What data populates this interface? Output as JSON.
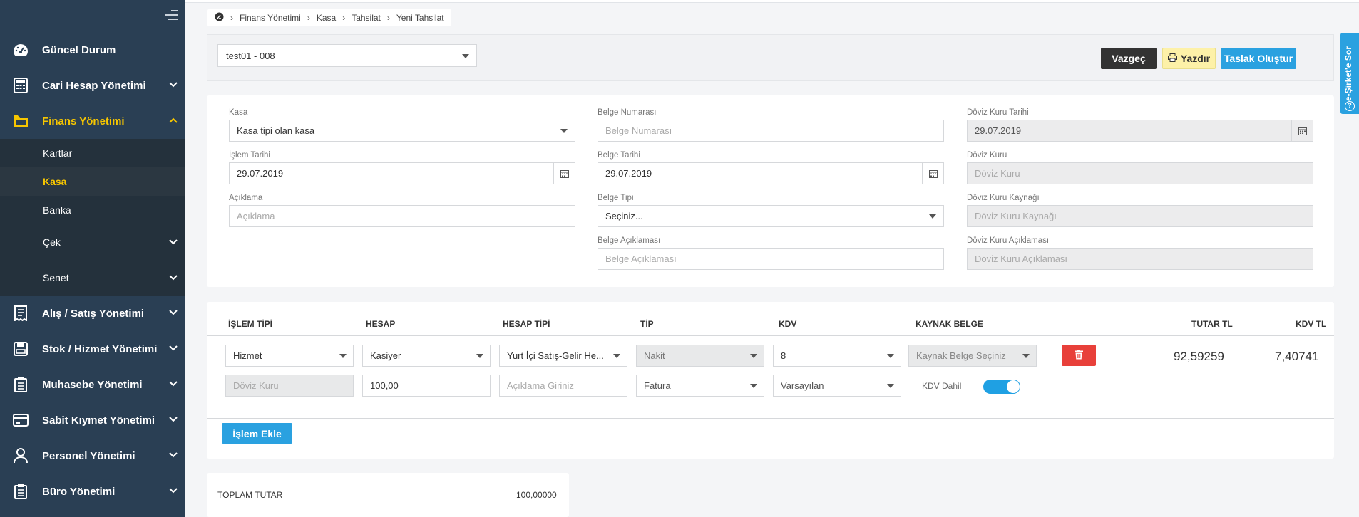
{
  "sidebar": {
    "items": [
      {
        "label": "Güncel Durum",
        "icon": "dashboard-icon"
      },
      {
        "label": "Cari Hesap Yönetimi",
        "icon": "calculator-icon"
      },
      {
        "label": "Finans Yönetimi",
        "icon": "finance-icon",
        "active": true
      },
      {
        "label": "Alış / Satış Yönetimi",
        "icon": "receipt-icon"
      },
      {
        "label": "Stok / Hizmet Yönetimi",
        "icon": "stock-icon"
      },
      {
        "label": "Muhasebe Yönetimi",
        "icon": "clipboard-icon"
      },
      {
        "label": "Sabit Kıymet Yönetimi",
        "icon": "credit-card-icon"
      },
      {
        "label": "Personel Yönetimi",
        "icon": "person-icon"
      },
      {
        "label": "Büro Yönetimi",
        "icon": "clipboard-icon"
      }
    ],
    "finance_sub": [
      {
        "label": "Kartlar"
      },
      {
        "label": "Kasa",
        "active": true
      },
      {
        "label": "Banka"
      },
      {
        "label": "Çek"
      },
      {
        "label": "Senet"
      }
    ]
  },
  "breadcrumb": [
    "Finans Yönetimi",
    "Kasa",
    "Tahsilat",
    "Yeni Tahsilat"
  ],
  "company_select": "test01 - 008",
  "buttons": {
    "cancel": "Vazgeç",
    "print": "Yazdır",
    "create_draft": "Taslak Oluştur",
    "add_line": "İşlem Ekle"
  },
  "side_tab": "e-Şirket'e Sor",
  "form": {
    "kasa": {
      "label": "Kasa",
      "value": "Kasa tipi olan kasa"
    },
    "islem_tarihi": {
      "label": "İşlem Tarihi",
      "value": "29.07.2019"
    },
    "aciklama": {
      "label": "Açıklama",
      "placeholder": "Açıklama"
    },
    "belge_numarasi": {
      "label": "Belge Numarası",
      "placeholder": "Belge Numarası"
    },
    "belge_tarihi": {
      "label": "Belge Tarihi",
      "value": "29.07.2019"
    },
    "belge_tipi": {
      "label": "Belge Tipi",
      "value": "Seçiniz..."
    },
    "belge_aciklamasi": {
      "label": "Belge Açıklaması",
      "placeholder": "Belge Açıklaması"
    },
    "doviz_kuru_tarihi": {
      "label": "Döviz Kuru Tarihi",
      "value": "29.07.2019"
    },
    "doviz_kuru": {
      "label": "Döviz Kuru",
      "placeholder": "Döviz Kuru"
    },
    "doviz_kuru_kaynagi": {
      "label": "Döviz Kuru Kaynağı",
      "placeholder": "Döviz Kuru Kaynağı"
    },
    "doviz_kuru_aciklamasi": {
      "label": "Döviz Kuru Açıklaması",
      "placeholder": "Döviz Kuru Açıklaması"
    }
  },
  "table": {
    "headers": [
      "İŞLEM TİPİ",
      "HESAP",
      "HESAP TİPİ",
      "TİP",
      "KDV",
      "KAYNAK BELGE",
      "TUTAR TL",
      "KDV TL"
    ],
    "row": {
      "islem_tipi": "Hizmet",
      "hesap": "Kasiyer",
      "hesap_tipi": "Yurt İçi Satış-Gelir He...",
      "tip": "Nakit",
      "kdv": "8",
      "kaynak_belge": "Kaynak Belge Seçiniz",
      "tutar_tl": "92,59259",
      "kdv_tl": "7,40741",
      "doviz_kuru_placeholder": "Döviz Kuru",
      "amount": "100,00",
      "aciklama_placeholder": "Açıklama Giriniz",
      "belge": "Fatura",
      "varsayilan": "Varsayılan",
      "kdv_dahil": "KDV Dahil",
      "kdv_dahil_on": true
    }
  },
  "total": {
    "label": "TOPLAM TUTAR",
    "value": "100,00000"
  },
  "colors": {
    "sidebar": "#2a3f54",
    "accent": "#f7c600",
    "primary": "#2aa1e0",
    "danger": "#e8403a"
  }
}
